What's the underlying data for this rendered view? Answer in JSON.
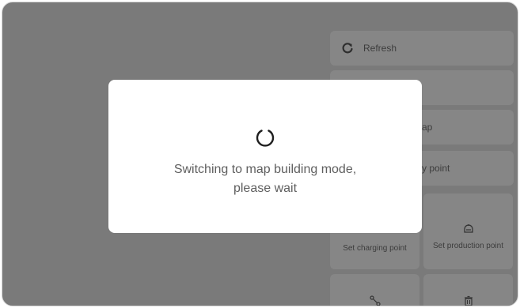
{
  "panel": {
    "refresh_label": "Refresh",
    "item2_label": "",
    "item3_label_partial": "ap",
    "item4_label_partial": "y point",
    "set_charging_label": "Set charging point",
    "set_production_label": "Set production point"
  },
  "modal": {
    "message_line1": "Switching to map building mode,",
    "message_line2": "please wait"
  },
  "colors": {
    "overlay_bg": "#7a7a7a",
    "tile_bg": "#868686",
    "modal_bg": "#ffffff",
    "text_gray": "#5f5f5f"
  },
  "icons": {
    "refresh": "refresh-icon",
    "production": "production-point-icon",
    "edit": "edit-path-icon",
    "delete": "trash-icon",
    "loading": "loading-spinner-icon"
  }
}
